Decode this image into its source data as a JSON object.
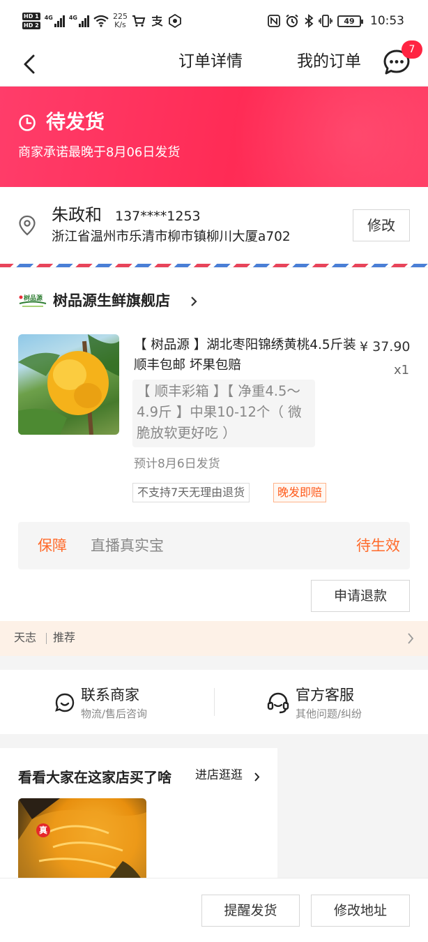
{
  "status_bar": {
    "hd_labels": [
      "HD 1",
      "HD 2"
    ],
    "network_1": "4G",
    "network_2": "4G",
    "speed_value": "225",
    "speed_unit": "K/s",
    "battery": "49",
    "time": "10:53",
    "icons": [
      "shopping-cart-icon",
      "alipay-icon",
      "app-icon",
      "nfc-icon",
      "alarm-icon",
      "bluetooth-icon",
      "vibrate-icon"
    ]
  },
  "nav": {
    "title": "订单详情",
    "my_orders": "我的订单",
    "message_badge": "7"
  },
  "order_status": {
    "title": "待发货",
    "subtitle": "商家承诺最晚于8月06日发货",
    "background": "#ff2b55"
  },
  "address": {
    "name": "朱政和",
    "phone": "137****1253",
    "detail": "浙江省温州市乐清市柳市镇柳川大厦a702",
    "edit_label": "修改"
  },
  "shop": {
    "logo_text": "树品源",
    "name": "树品源生鲜旗舰店"
  },
  "product": {
    "title": "【 树品源 】湖北枣阳锦绣黄桃4.5斤装 顺丰包邮 坏果包赔",
    "price": "¥ 37.90",
    "quantity": "x1",
    "sku": "【 顺丰彩箱 】【 净重4.5～4.9斤 】中果10-12个（ 微脆放软更好吃 ）",
    "shipping_estimate": "预计8月6日发货",
    "tags": [
      "不支持7天无理由退货",
      "晚发即赔"
    ]
  },
  "guarantee": {
    "label": "保障",
    "name": "直播真实宝",
    "status": "待生效",
    "accent": "#ff6a2a"
  },
  "refund_label": "申请退款",
  "recommend": {
    "left": "天志",
    "right": "推荐"
  },
  "contact": {
    "merchant_title": "联系商家",
    "merchant_sub": "物流/售后咨询",
    "service_title": "官方客服",
    "service_sub": "其他问题/纠纷"
  },
  "others": {
    "title": "看看大家在这家店买了啥",
    "link": "进店逛逛",
    "image_tag": "真"
  },
  "bottom": {
    "remind_label": "提醒发货",
    "change_address_label": "修改地址"
  }
}
